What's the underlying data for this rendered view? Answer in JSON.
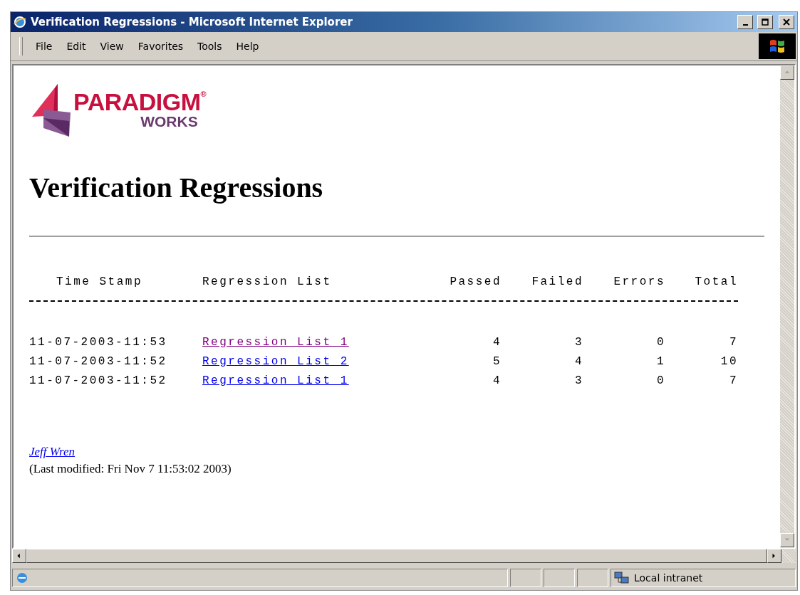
{
  "window": {
    "title": "Verification Regressions - Microsoft Internet Explorer"
  },
  "menu": [
    {
      "label": "File"
    },
    {
      "label": "Edit"
    },
    {
      "label": "View"
    },
    {
      "label": "Favorites"
    },
    {
      "label": "Tools"
    },
    {
      "label": "Help"
    }
  ],
  "logo": {
    "name": "PARADIGM",
    "mark": "®",
    "sub": "WORKS"
  },
  "heading": "Verification Regressions",
  "table": {
    "columns": [
      "Time Stamp",
      "Regression List",
      "Passed",
      "Failed",
      "Errors",
      "Total"
    ],
    "rows": [
      {
        "time": "11-07-2003-11:53",
        "list": "Regression_List_1",
        "visited": true,
        "passed": "4",
        "failed": "3",
        "errors": "0",
        "total": "7"
      },
      {
        "time": "11-07-2003-11:52",
        "list": "Regression_List_2",
        "visited": false,
        "passed": "5",
        "failed": "4",
        "errors": "1",
        "total": "10"
      },
      {
        "time": "11-07-2003-11:52",
        "list": "Regression_List_1",
        "visited": false,
        "passed": "4",
        "failed": "3",
        "errors": "0",
        "total": "7"
      }
    ]
  },
  "author": "Jeff Wren",
  "modified": "(Last modified: Fri Nov 7 11:53:02 2003)",
  "status_bar": {
    "zone": "Local intranet"
  }
}
